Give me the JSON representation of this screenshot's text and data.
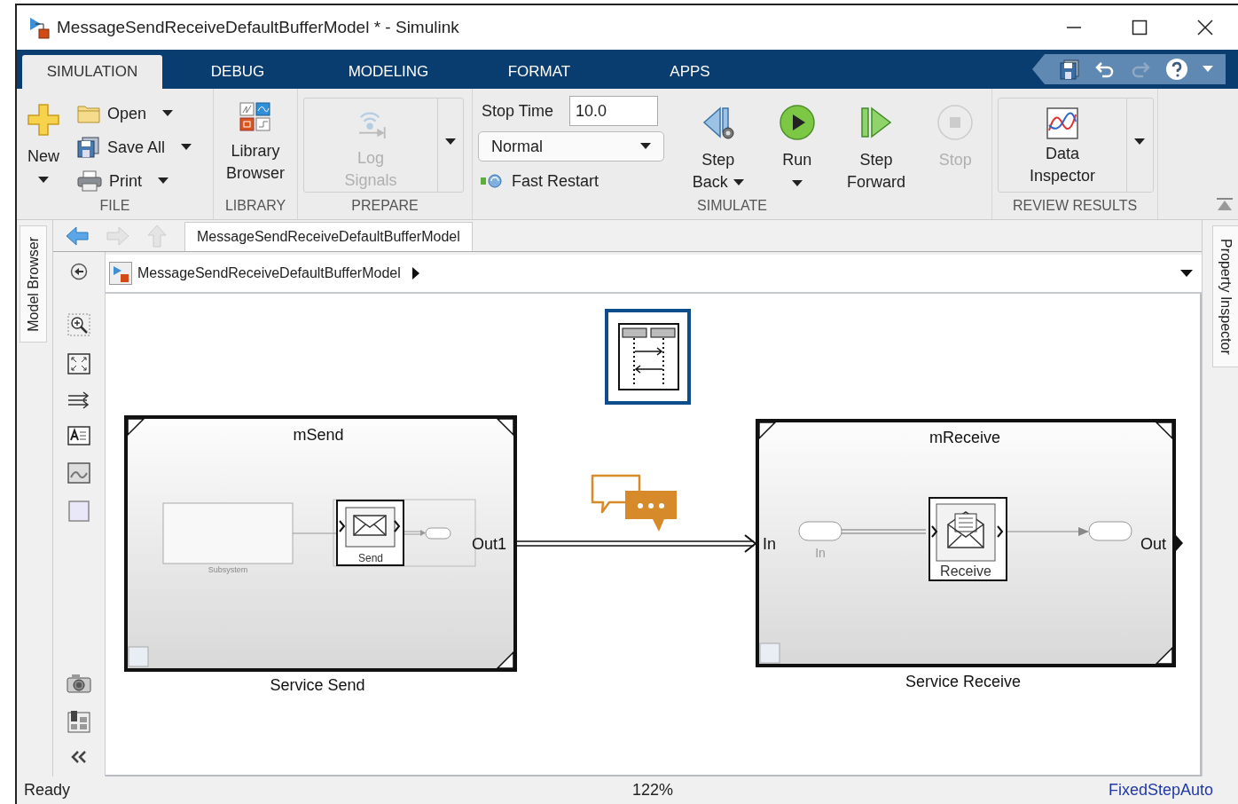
{
  "window": {
    "title": "MessageSendReceiveDefaultBufferModel * - Simulink"
  },
  "tabs": [
    {
      "label": "SIMULATION",
      "selected": true
    },
    {
      "label": "DEBUG",
      "selected": false
    },
    {
      "label": "MODELING",
      "selected": false
    },
    {
      "label": "FORMAT",
      "selected": false
    },
    {
      "label": "APPS",
      "selected": false
    }
  ],
  "ribbon": {
    "file": {
      "label": "FILE",
      "new": "New",
      "items": [
        {
          "kind": "open",
          "label": "Open"
        },
        {
          "kind": "save",
          "label": "Save All"
        },
        {
          "kind": "print",
          "label": "Print"
        }
      ]
    },
    "library": {
      "label": "LIBRARY",
      "button": "Library Browser"
    },
    "prepare": {
      "label": "PREPARE",
      "button": {
        "label": "Log Signals",
        "disabled": true
      }
    },
    "simulate": {
      "label": "SIMULATE",
      "stop_time_label": "Stop Time",
      "stop_time": "10.0",
      "mode": "Normal",
      "fast_restart": "Fast Restart",
      "buttons": [
        {
          "kind": "step-back",
          "label": "Step Back",
          "disabled": false,
          "menu": true
        },
        {
          "kind": "run",
          "label": "Run",
          "disabled": false,
          "menu": true
        },
        {
          "kind": "step-forward",
          "label": "Step Forward",
          "disabled": false,
          "menu": false
        },
        {
          "kind": "stop",
          "label": "Stop",
          "disabled": true,
          "menu": false
        }
      ]
    },
    "review": {
      "label": "REVIEW RESULTS",
      "button": "Data Inspector"
    }
  },
  "editor": {
    "model_browser": "Model Browser",
    "property_inspector": "Property Inspector",
    "tab": "MessageSendReceiveDefaultBufferModel",
    "breadcrumb": "MessageSendReceiveDefaultBufferModel",
    "diagram": {
      "send": {
        "title": "mSend",
        "caption": "Service Send",
        "port": "Out1",
        "inner_subsystem": "Subsystem",
        "inner_block": "Send"
      },
      "receive": {
        "title": "mReceive",
        "caption": "Service Receive",
        "in_port": "In",
        "out_port": "Out",
        "inner_in": "In",
        "inner_block": "Receive"
      }
    }
  },
  "status_bar": {
    "state": "Ready",
    "zoom": "122%",
    "solver": "FixedStepAuto"
  }
}
